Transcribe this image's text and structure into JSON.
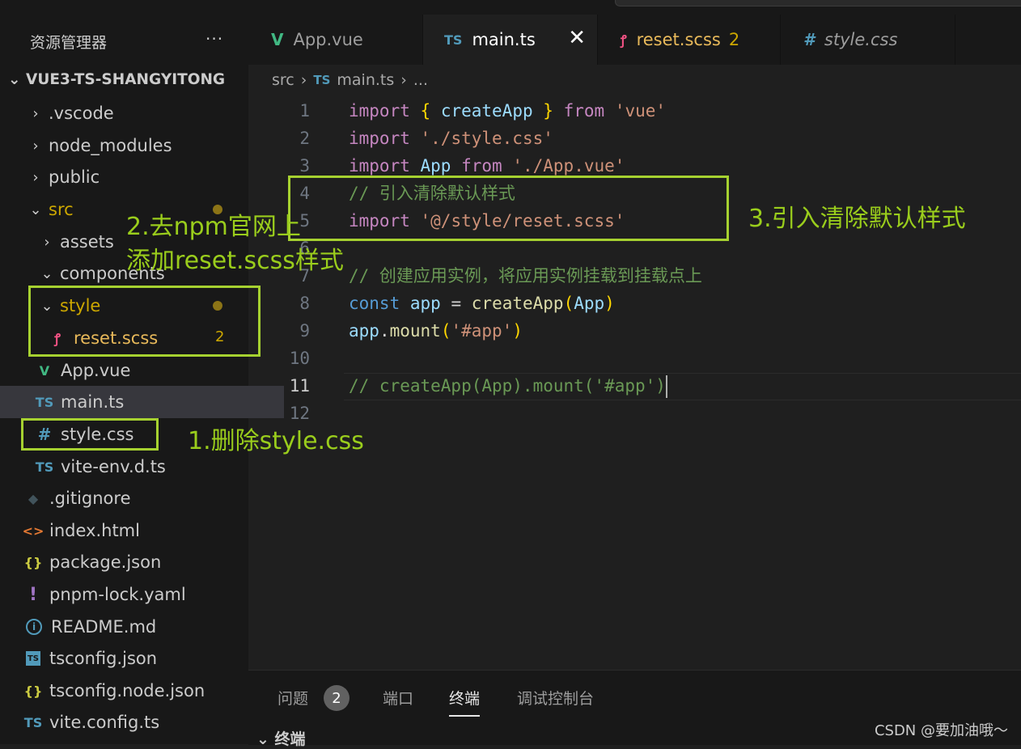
{
  "sidebar": {
    "title": "资源管理器",
    "more": "···",
    "project": "VUE3-TS-SHANGYITONG",
    "items": [
      {
        "label": ".vscode"
      },
      {
        "label": "node_modules"
      },
      {
        "label": "public"
      },
      {
        "label": "src"
      },
      {
        "label": "assets"
      },
      {
        "label": "components"
      },
      {
        "label": "style"
      },
      {
        "label": "reset.scss",
        "badge": "2"
      },
      {
        "label": "App.vue"
      },
      {
        "label": "main.ts"
      },
      {
        "label": "style.css"
      },
      {
        "label": "vite-env.d.ts"
      },
      {
        "label": ".gitignore"
      },
      {
        "label": "index.html"
      },
      {
        "label": "package.json"
      },
      {
        "label": "pnpm-lock.yaml"
      },
      {
        "label": "README.md"
      },
      {
        "label": "tsconfig.json"
      },
      {
        "label": "tsconfig.node.json"
      },
      {
        "label": "vite.config.ts"
      }
    ],
    "icons": {
      "ts": "TS",
      "hash": "#",
      "braces": "{}",
      "bang": "!",
      "info": "i",
      "html": "<>",
      "vue": "V"
    }
  },
  "tabs": [
    {
      "label": "App.vue"
    },
    {
      "label": "main.ts",
      "close": "✕"
    },
    {
      "label": "reset.scss",
      "badge": "2"
    },
    {
      "label": "style.css"
    }
  ],
  "breadcrumb": {
    "folder": "src",
    "sep": "›",
    "file": "main.ts",
    "rest": "..."
  },
  "code": {
    "line_numbers": [
      "1",
      "2",
      "3",
      "4",
      "5",
      "6",
      "7",
      "8",
      "9",
      "10",
      "11",
      "12"
    ],
    "l1": [
      "import",
      "{",
      "createApp",
      "}",
      "from",
      "'vue'"
    ],
    "l2": [
      "import",
      "'./style.css'"
    ],
    "l3": [
      "import",
      "App",
      "from",
      "'./App.vue'"
    ],
    "l4": "// 引入清除默认样式",
    "l5": [
      "import",
      "'@/style/reset.scss'"
    ],
    "l7": "// 创建应用实例，将应用实例挂载到挂载点上",
    "l8": [
      "const",
      "app",
      "=",
      "createApp",
      "(",
      "App",
      ")"
    ],
    "l9": [
      "app",
      ".",
      "mount",
      "(",
      "'#app'",
      ")"
    ],
    "l11": "// createApp(App).mount('#app')"
  },
  "annotations": {
    "a1": "1.删除style.css",
    "a2_line1": "2.去npm官网上",
    "a2_line2": "添加reset.scss样式",
    "a3": "3.引入清除默认样式"
  },
  "panel": {
    "tabs": [
      "问题",
      "端口",
      "终端",
      "调试控制台"
    ],
    "problems_badge": "2",
    "terminal_header": "终端",
    "watermark": "CSDN @要加油哦～"
  },
  "colors": {
    "accent_annotation": "#9acd1c",
    "modified": "#cca700",
    "keyword": "#c586c0",
    "string": "#ce9178",
    "comment": "#6a9955"
  }
}
